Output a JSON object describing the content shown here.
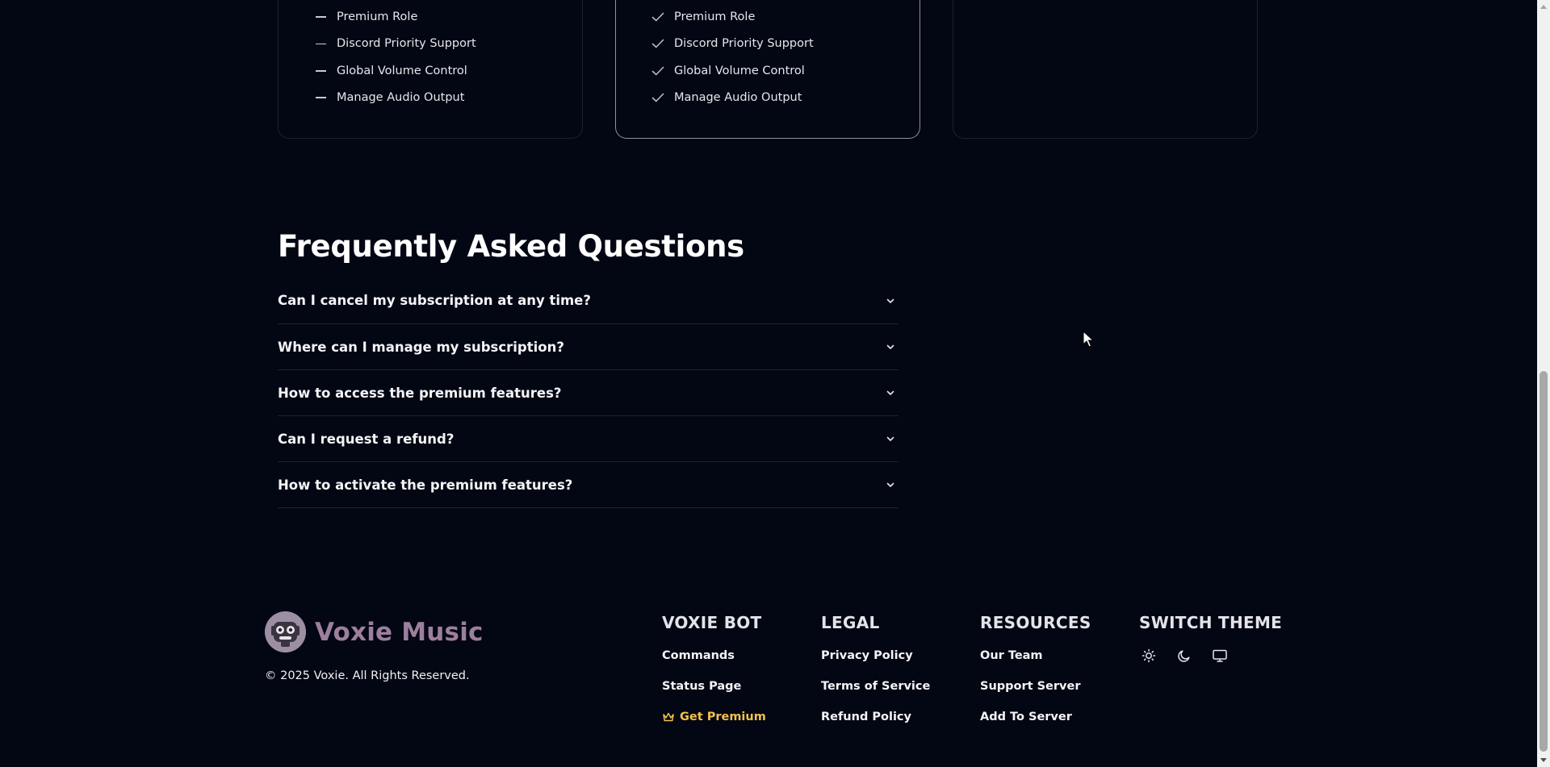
{
  "pricing": {
    "free_card": {
      "features": [
        "Premium Role",
        "Discord Priority Support",
        "Global Volume Control",
        "Manage Audio Output"
      ]
    },
    "premium_card": {
      "features": [
        "Premium Role",
        "Discord Priority Support",
        "Global Volume Control",
        "Manage Audio Output"
      ]
    }
  },
  "faq": {
    "title": "Frequently Asked Questions",
    "items": [
      {
        "question": "Can I cancel my subscription at any time?"
      },
      {
        "question": "Where can I manage my subscription?"
      },
      {
        "question": "How to access the premium features?"
      },
      {
        "question": "Can I request a refund?"
      },
      {
        "question": "How to activate the premium features?"
      }
    ]
  },
  "footer": {
    "brand_name": "Voxie Music",
    "copyright": "© 2025 Voxie. All Rights Reserved.",
    "columns": [
      {
        "heading": "VOXIE BOT",
        "links": [
          "Commands",
          "Status Page",
          "Get Premium"
        ]
      },
      {
        "heading": "LEGAL",
        "links": [
          "Privacy Policy",
          "Terms of Service",
          "Refund Policy"
        ]
      },
      {
        "heading": "RESOURCES",
        "links": [
          "Our Team",
          "Support Server",
          "Add To Server"
        ]
      },
      {
        "heading": "SWITCH THEME",
        "icons": [
          "sun-icon",
          "moon-icon",
          "monitor-icon"
        ]
      }
    ]
  },
  "colors": {
    "background": "#030613",
    "premium_accent": "#f2c14e",
    "brand": "#9c7f9d",
    "divider": "#1d2231"
  }
}
